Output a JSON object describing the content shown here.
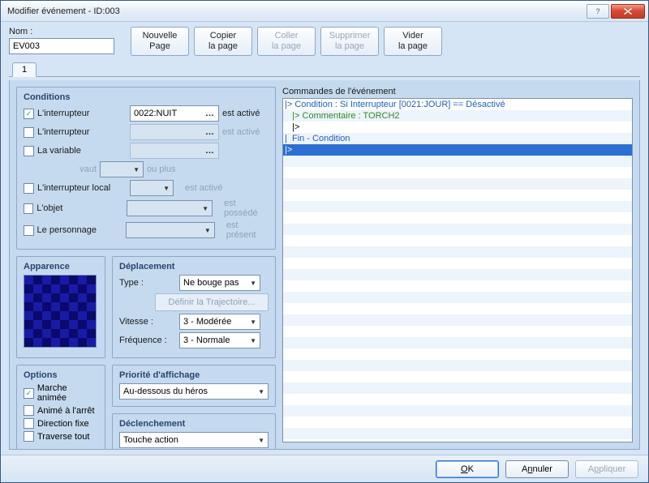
{
  "window": {
    "title": "Modifier événement - ID:003"
  },
  "name": {
    "label": "Nom :",
    "value": "EV003"
  },
  "page_buttons": {
    "new": {
      "l1": "Nouvelle",
      "l2": "Page"
    },
    "copy": {
      "l1": "Copier",
      "l2": "la page"
    },
    "paste": {
      "l1": "Coller",
      "l2": "la page"
    },
    "del": {
      "l1": "Supprimer",
      "l2": "la page"
    },
    "clear": {
      "l1": "Vider",
      "l2": "la page"
    }
  },
  "tab": "1",
  "conditions": {
    "title": "Conditions",
    "switch1": {
      "label": "L'interrupteur",
      "value": "0022:NUIT",
      "suffix": "est activé",
      "checked": true
    },
    "switch2": {
      "label": "L'interrupteur",
      "value": "",
      "suffix": "est activé",
      "checked": false
    },
    "variable": {
      "label": "La variable",
      "value": "",
      "checked": false,
      "vaut": "vaut",
      "num": "",
      "ouplus": "ou plus"
    },
    "self_sw": {
      "label": "L'interrupteur local",
      "value": "",
      "suffix": "est activé",
      "checked": false
    },
    "item": {
      "label": "L'objet",
      "value": "",
      "suffix": "est possédé",
      "checked": false
    },
    "actor": {
      "label": "Le personnage",
      "value": "",
      "suffix": "est présent",
      "checked": false
    }
  },
  "appearance": {
    "title": "Apparence"
  },
  "movement": {
    "title": "Déplacement",
    "type_label": "Type :",
    "type": "Ne bouge pas",
    "traj": "Définir la Trajectoire...",
    "speed_label": "Vitesse :",
    "speed": "3 - Modérée",
    "freq_label": "Fréquence :",
    "freq": "3 - Normale"
  },
  "options": {
    "title": "Options",
    "walk": {
      "label": "Marche animée",
      "checked": true
    },
    "step": {
      "label": "Animé à l'arrêt",
      "checked": false
    },
    "dir": {
      "label": "Direction fixe",
      "checked": false
    },
    "thru": {
      "label": "Traverse tout",
      "checked": false
    }
  },
  "priority": {
    "title": "Priorité d'affichage",
    "value": "Au-dessous du héros"
  },
  "trigger": {
    "title": "Déclenchement",
    "value": "Touche action"
  },
  "commands": {
    "title": "Commandes de l'événement",
    "lines": [
      {
        "text": "|> Condition : Si Interrupteur [0021:JOUR] == Désactivé",
        "cls": "c-blue"
      },
      {
        "text": "   |> Commentaire : TORCH2",
        "cls": "c-green"
      },
      {
        "text": "   |>",
        "cls": ""
      },
      {
        "text": "|  Fin - Condition",
        "cls": "c-blue"
      },
      {
        "text": "|>",
        "cls": "sel"
      }
    ]
  },
  "footer": {
    "ok": "OK",
    "cancel": "Annuler",
    "apply": "Appliquer"
  }
}
